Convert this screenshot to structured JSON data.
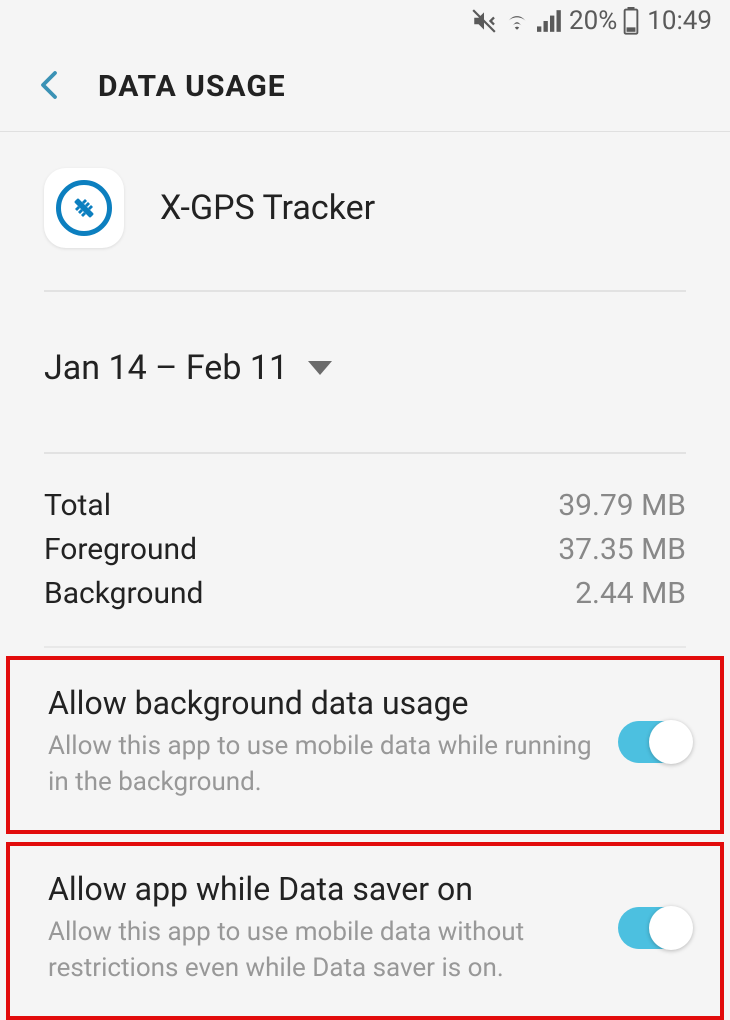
{
  "status_bar": {
    "battery_pct": "20%",
    "time": "10:49"
  },
  "header": {
    "title": "DATA USAGE"
  },
  "app": {
    "name": "X-GPS Tracker"
  },
  "date_range": {
    "label": "Jan 14 – Feb 11"
  },
  "stats": {
    "total_label": "Total",
    "total_value": "39.79 MB",
    "foreground_label": "Foreground",
    "foreground_value": "37.35 MB",
    "background_label": "Background",
    "background_value": "2.44 MB"
  },
  "settings": {
    "bg_data": {
      "title": "Allow background data usage",
      "desc": "Allow this app to use mobile data while running in the background.",
      "enabled": true
    },
    "data_saver": {
      "title": "Allow app while Data saver on",
      "desc": "Allow this app to use mobile data without restrictions even while Data saver is on.",
      "enabled": true
    }
  }
}
